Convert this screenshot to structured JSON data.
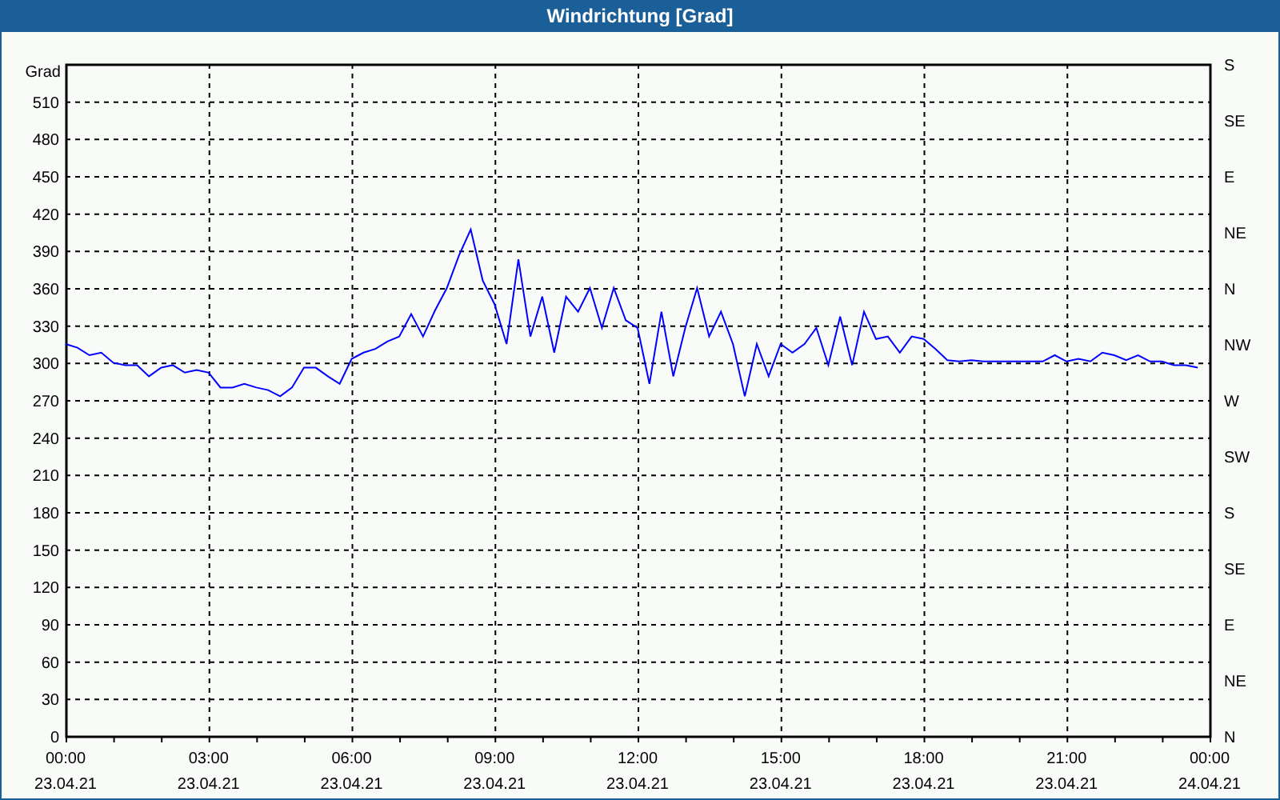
{
  "window": {
    "title": "Windrichtung [Grad]"
  },
  "chart_data": {
    "type": "line",
    "ylabel": "Grad",
    "xlim": [
      0,
      24
    ],
    "ylim": [
      0,
      540
    ],
    "grid": true,
    "yticks": [
      0,
      30,
      60,
      90,
      120,
      150,
      180,
      210,
      240,
      270,
      300,
      330,
      360,
      390,
      420,
      450,
      480,
      510
    ],
    "xticks": [
      {
        "value": 0,
        "label": "00:00"
      },
      {
        "value": 3,
        "label": "03:00"
      },
      {
        "value": 6,
        "label": "06:00"
      },
      {
        "value": 9,
        "label": "09:00"
      },
      {
        "value": 12,
        "label": "12:00"
      },
      {
        "value": 15,
        "label": "15:00"
      },
      {
        "value": 18,
        "label": "18:00"
      },
      {
        "value": 21,
        "label": "21:00"
      },
      {
        "value": 24,
        "label": "00:00"
      }
    ],
    "x": [
      0,
      0.25,
      0.5,
      0.75,
      1,
      1.25,
      1.5,
      1.75,
      2,
      2.25,
      2.5,
      2.75,
      3,
      3.25,
      3.5,
      3.75,
      4,
      4.25,
      4.5,
      4.75,
      5,
      5.25,
      5.5,
      5.75,
      6,
      6.25,
      6.5,
      6.75,
      7,
      7.25,
      7.5,
      7.75,
      8,
      8.25,
      8.5,
      8.75,
      9,
      9.25,
      9.5,
      9.75,
      10,
      10.25,
      10.5,
      10.75,
      11,
      11.25,
      11.5,
      11.75,
      12,
      12.25,
      12.5,
      12.75,
      13,
      13.25,
      13.5,
      13.75,
      14,
      14.25,
      14.5,
      14.75,
      15,
      15.25,
      15.5,
      15.75,
      16,
      16.25,
      16.5,
      16.75,
      17,
      17.25,
      17.5,
      17.75,
      18,
      18.25,
      18.5,
      18.75,
      19,
      19.25,
      19.5,
      19.75,
      20,
      20.25,
      20.5,
      20.75,
      21,
      21.25,
      21.5,
      21.75,
      22,
      22.25,
      22.5,
      22.75,
      23,
      23.25,
      23.5,
      23.75
    ],
    "series": [
      {
        "color": "#0000ff",
        "values": [
          315,
          312,
          306,
          308,
          300,
          298,
          298,
          289,
          296,
          298,
          292,
          294,
          292,
          280,
          280,
          283,
          280,
          278,
          273,
          280,
          296,
          296,
          289,
          283,
          303,
          308,
          311,
          317,
          321,
          339,
          321,
          342,
          360,
          386,
          407,
          366,
          347,
          315,
          383,
          321,
          353,
          308,
          353,
          341,
          360,
          328,
          360,
          334,
          328,
          283,
          341,
          289,
          328,
          360,
          321,
          341,
          315,
          273,
          315,
          289,
          315,
          308,
          315,
          328,
          298,
          337,
          298,
          341,
          319,
          321,
          308,
          321,
          319,
          311,
          302,
          301,
          302,
          301,
          301,
          301,
          301,
          301,
          301,
          306,
          301,
          303,
          301,
          308,
          306,
          302,
          306,
          301,
          301,
          298,
          298,
          296
        ]
      }
    ]
  },
  "x_axis_dates": [
    "23.04.21",
    "23.04.21",
    "23.04.21",
    "23.04.21",
    "23.04.21",
    "23.04.21",
    "23.04.21",
    "23.04.21",
    "24.04.21"
  ],
  "compass_axis_labels": [
    "S",
    "SE",
    "E",
    "NE",
    "N",
    "NW",
    "W",
    "SW",
    "S",
    "SE",
    "E",
    "NE",
    "N"
  ]
}
